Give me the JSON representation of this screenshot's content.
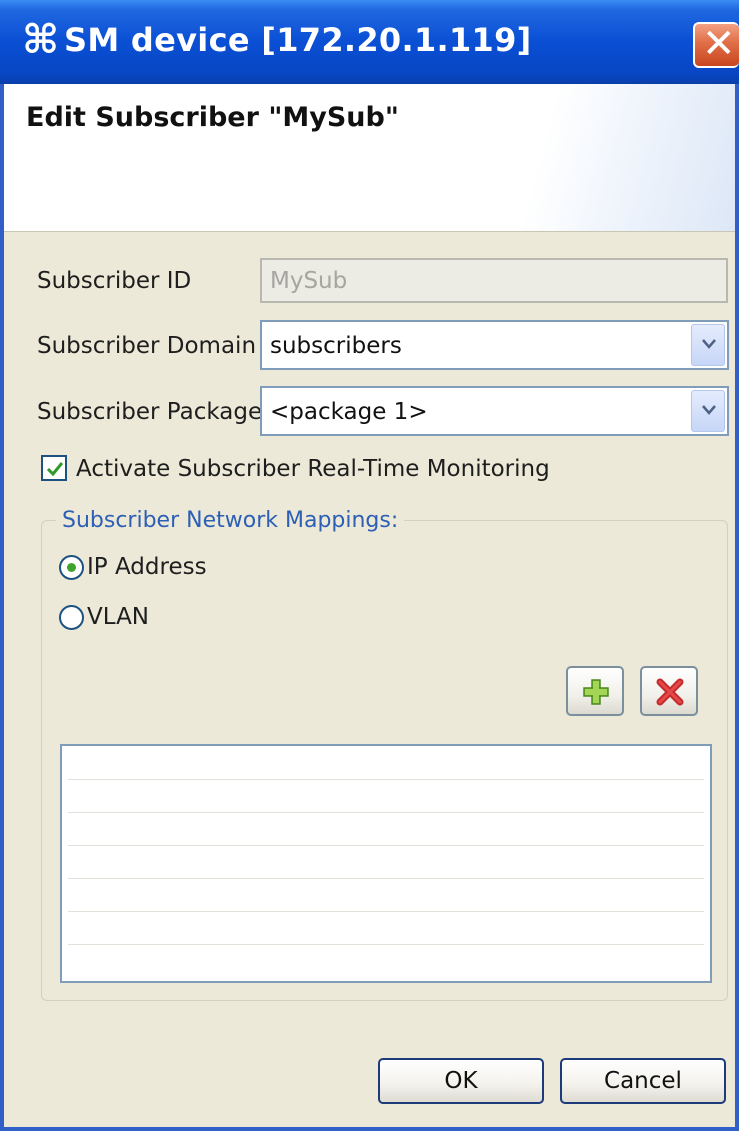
{
  "window": {
    "title": "SM device [172.20.1.119]",
    "app_icon": "command-icon",
    "close_icon": "close-icon",
    "accent_color": "#0a4fd4",
    "close_color": "#e06e47"
  },
  "banner": {
    "title": "Edit Subscriber \"MySub\""
  },
  "form": {
    "subscriber_id": {
      "label": "Subscriber ID",
      "value": "MySub"
    },
    "subscriber_domain": {
      "label": "Subscriber Domain",
      "value": "subscribers"
    },
    "subscriber_package": {
      "label": "Subscriber Package",
      "value": "<package 1>"
    },
    "monitoring": {
      "label": "Activate Subscriber Real-Time Monitoring",
      "checked": true
    }
  },
  "mappings": {
    "legend": "Subscriber Network Mappings:",
    "options": [
      {
        "label": "IP Address",
        "selected": true
      },
      {
        "label": "VLAN",
        "selected": false
      }
    ],
    "add_icon": "plus-icon",
    "remove_icon": "delete-x-icon",
    "rows": [
      "",
      "",
      "",
      "",
      "",
      "",
      ""
    ]
  },
  "buttons": {
    "ok": "OK",
    "cancel": "Cancel"
  }
}
